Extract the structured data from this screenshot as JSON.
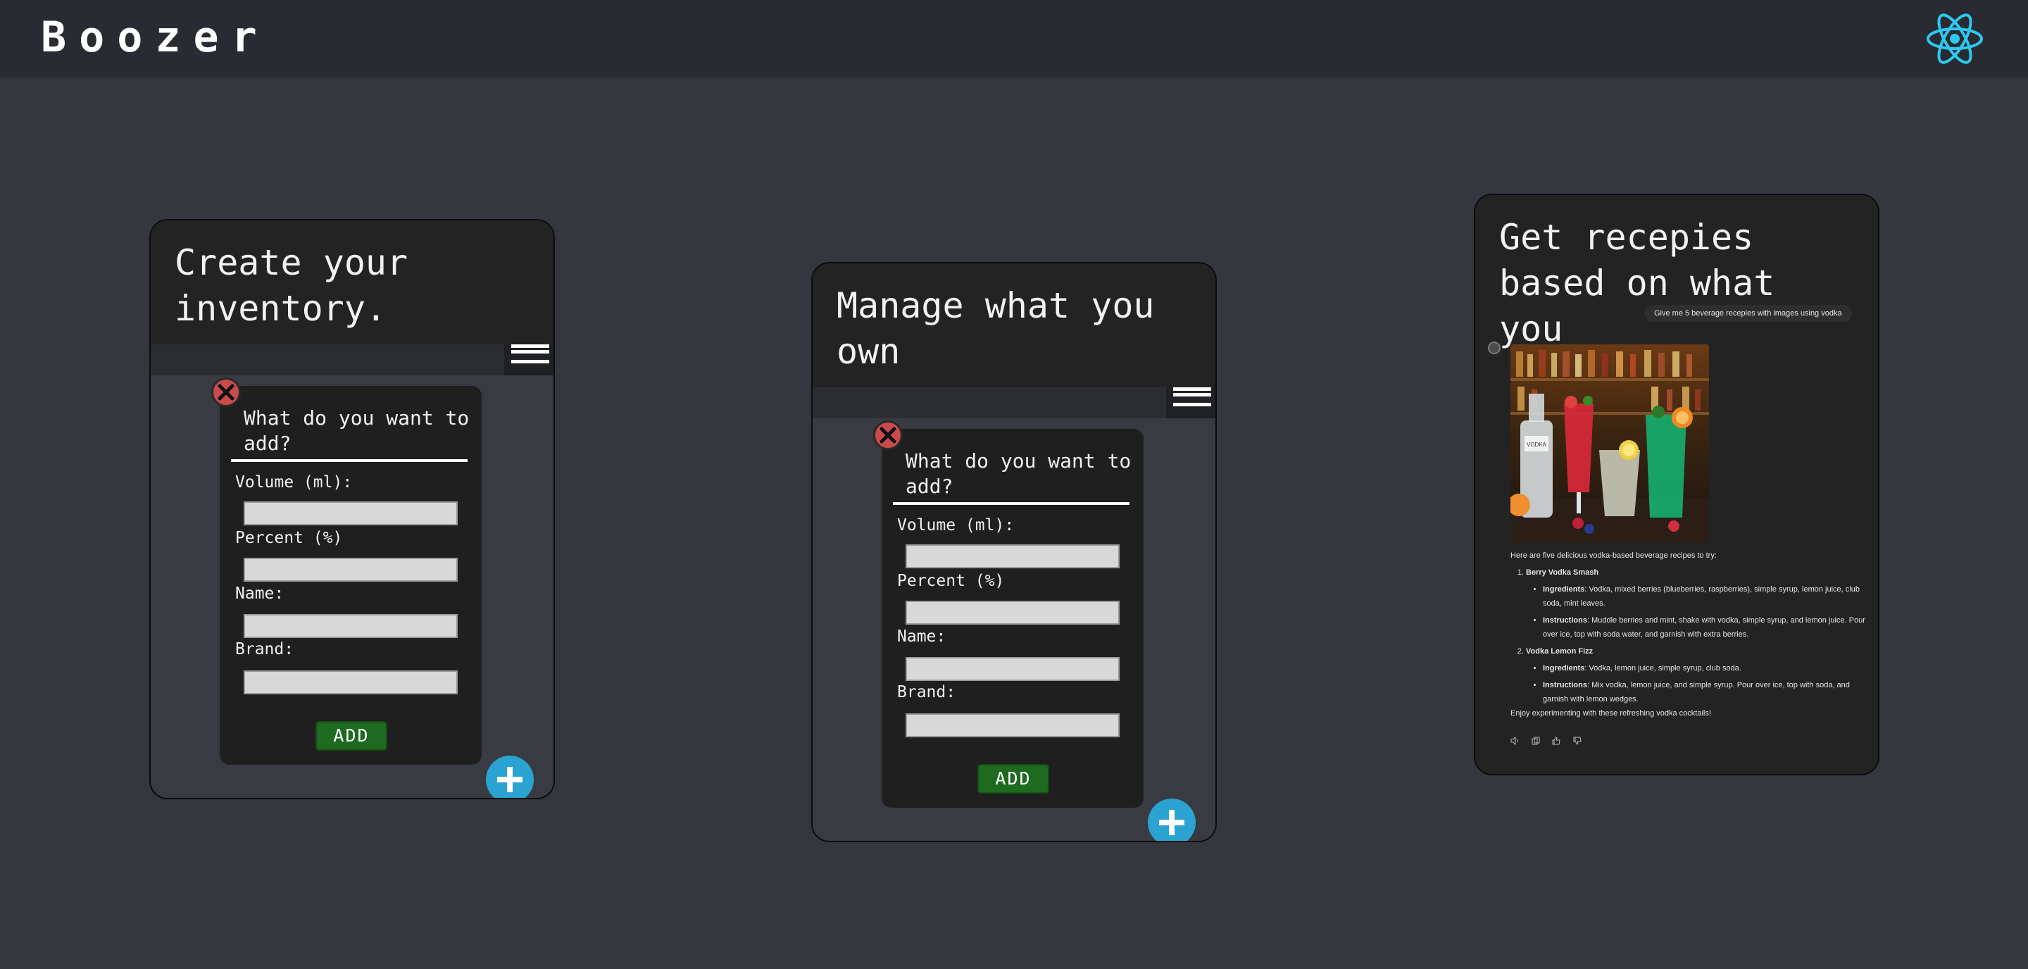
{
  "app": {
    "title": "Boozer",
    "logo_icon": "react-logo-icon",
    "accent": "#2aa3d2",
    "logo_color": "#2fc8f0"
  },
  "cards": [
    {
      "title": "Create your\ninventory.",
      "menu_icon": "hamburger-menu-icon",
      "form": {
        "question": "What do you want to add?",
        "fields": [
          {
            "label": "Volume (ml):",
            "value": ""
          },
          {
            "label": "Percent (%)",
            "value": ""
          },
          {
            "label": "Name:",
            "value": ""
          },
          {
            "label": "Brand:",
            "value": ""
          }
        ],
        "submit_label": "ADD",
        "close_icon": "close-icon"
      },
      "fab_icon": "plus-icon"
    },
    {
      "title": "Manage what you\nown",
      "menu_icon": "hamburger-menu-icon",
      "form": {
        "question": "What do you want to add?",
        "fields": [
          {
            "label": "Volume (ml):",
            "value": ""
          },
          {
            "label": "Percent (%)",
            "value": ""
          },
          {
            "label": "Name:",
            "value": ""
          },
          {
            "label": "Brand:",
            "value": ""
          }
        ],
        "submit_label": "ADD",
        "close_icon": "close-icon"
      },
      "fab_icon": "plus-icon"
    },
    {
      "title": "Get recepies\nbased on what you",
      "chat": {
        "prompt": "Give me 5 beverage recepies with images using vodka",
        "intro": "Here are five delicious vodka-based beverage recipes to try:",
        "recipes": [
          {
            "name": "Berry Vodka Smash",
            "ingredients_label": "Ingredients",
            "ingredients": ": Vodka, mixed berries (blueberries, raspberries), simple syrup, lemon juice, club soda, mint leaves.",
            "instructions_label": "Instructions",
            "instructions": ": Muddle berries and mint, shake with vodka, simple syrup, and lemon juice. Pour over ice, top with soda water, and garnish with extra berries."
          },
          {
            "name": "Vodka Lemon Fizz",
            "ingredients_label": "Ingredients",
            "ingredients": ": Vodka, lemon juice, simple syrup, club soda.",
            "instructions_label": "Instructions",
            "instructions": ": Mix vodka, lemon juice, and simple syrup. Pour over ice, top with soda, and garnish with lemon wedges."
          }
        ],
        "outro": "Enjoy experimenting with these refreshing vodka cocktails!",
        "actions": [
          "speaker-icon",
          "copy-icon",
          "thumbs-up-icon",
          "thumbs-down-icon"
        ]
      }
    }
  ]
}
